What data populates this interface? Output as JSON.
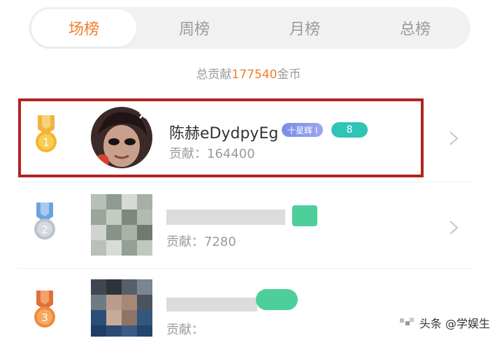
{
  "tabs": [
    {
      "label": "场榜",
      "active": true
    },
    {
      "label": "周榜",
      "active": false
    },
    {
      "label": "月榜",
      "active": false
    },
    {
      "label": "总榜",
      "active": false
    }
  ],
  "summary": {
    "prefix": "总贡献",
    "amount": "177540",
    "suffix": "金币"
  },
  "rows": [
    {
      "rank": "1",
      "name": "陈赫eDydpyEg",
      "star_badge": "十星辉 I",
      "level": "8",
      "contribution": "贡献：164400"
    },
    {
      "rank": "2",
      "contribution": "贡献：7280"
    },
    {
      "rank": "3",
      "contribution": "贡献："
    }
  ],
  "watermark": "头条 @学娱生",
  "colors": {
    "accent": "#f07e2c",
    "highlight_border": "#b42222",
    "level_badge": "#2ec4b6"
  }
}
